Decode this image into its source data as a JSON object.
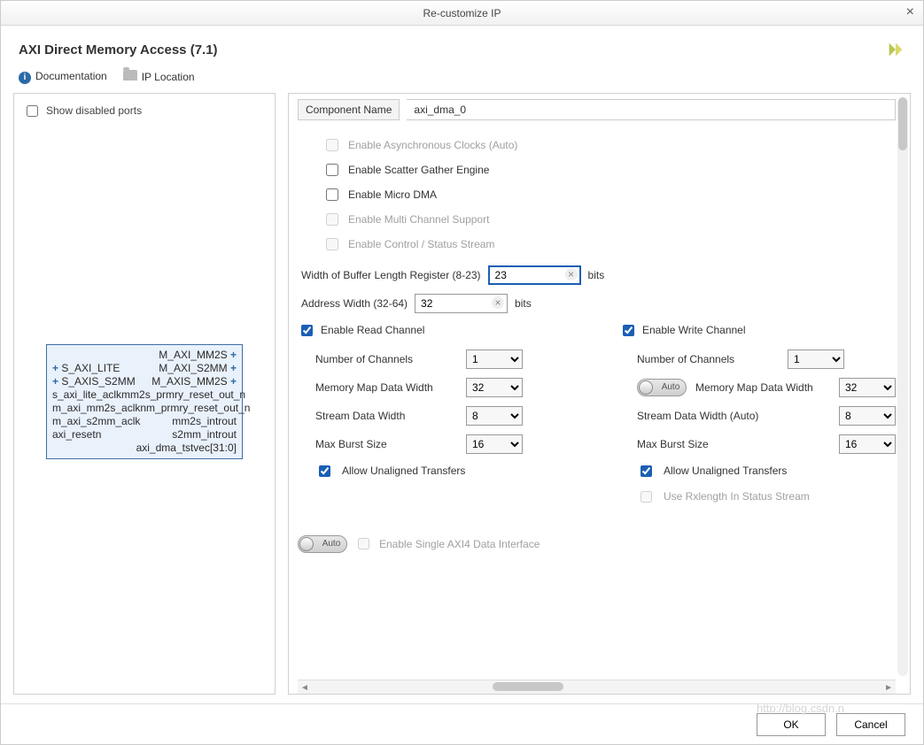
{
  "dialog_title": "Re-customize IP",
  "ip_title": "AXI Direct Memory Access (7.1)",
  "links": {
    "documentation": "Documentation",
    "ip_location": "IP Location"
  },
  "left": {
    "show_disabled_ports": "Show disabled ports",
    "block": {
      "rows": [
        {
          "l": "",
          "r": "M_AXI_MM2S",
          "lp": "",
          "rp": "+"
        },
        {
          "l": "S_AXI_LITE",
          "r": "M_AXI_S2MM",
          "lp": "+",
          "rp": "+"
        },
        {
          "l": "S_AXIS_S2MM",
          "r": "M_AXIS_MM2S",
          "lp": "+",
          "rp": "+"
        },
        {
          "l": "s_axi_lite_aclk",
          "r": "mm2s_prmry_reset_out_n",
          "lp": "",
          "rp": ""
        },
        {
          "l": "m_axi_mm2s_aclk",
          "r": "nm_prmry_reset_out_n",
          "lp": "",
          "rp": ""
        },
        {
          "l": "m_axi_s2mm_aclk",
          "r": "mm2s_introut",
          "lp": "",
          "rp": ""
        },
        {
          "l": "axi_resetn",
          "r": "s2mm_introut",
          "lp": "",
          "rp": ""
        },
        {
          "l": "",
          "r": "axi_dma_tstvec[31:0]",
          "lp": "",
          "rp": ""
        }
      ]
    }
  },
  "right": {
    "component_name_label": "Component Name",
    "component_name_value": "axi_dma_0",
    "opts": {
      "async_clocks": "Enable Asynchronous Clocks (Auto)",
      "scatter_gather": "Enable Scatter Gather Engine",
      "micro_dma": "Enable Micro DMA",
      "multi_channel": "Enable Multi Channel Support",
      "ctrl_status": "Enable Control / Status Stream"
    },
    "buf_len_label": "Width of Buffer Length Register (8-23)",
    "buf_len_value": "23",
    "addr_width_label": "Address Width (32-64)",
    "addr_width_value": "32",
    "bits": "bits",
    "read": {
      "title": "Enable Read Channel",
      "num_channels_label": "Number of Channels",
      "num_channels": "1",
      "mm_width_label": "Memory Map Data Width",
      "mm_width": "32",
      "stream_width_label": "Stream Data Width",
      "stream_width": "8",
      "burst_label": "Max Burst Size",
      "burst": "16",
      "unaligned": "Allow Unaligned Transfers"
    },
    "write": {
      "title": "Enable Write Channel",
      "num_channels_label": "Number of Channels",
      "num_channels": "1",
      "mm_width_label": "Memory Map Data Width",
      "mm_width": "32",
      "stream_width_label": "Stream Data Width (Auto)",
      "stream_width": "8",
      "burst_label": "Max Burst Size",
      "burst": "16",
      "unaligned": "Allow Unaligned Transfers",
      "rxlength": "Use Rxlength In Status Stream"
    },
    "auto_label": "Auto",
    "single_axi4": "Enable Single AXI4 Data Interface"
  },
  "footer": {
    "ok": "OK",
    "cancel": "Cancel"
  },
  "watermark": "http://blog.csdn.n"
}
